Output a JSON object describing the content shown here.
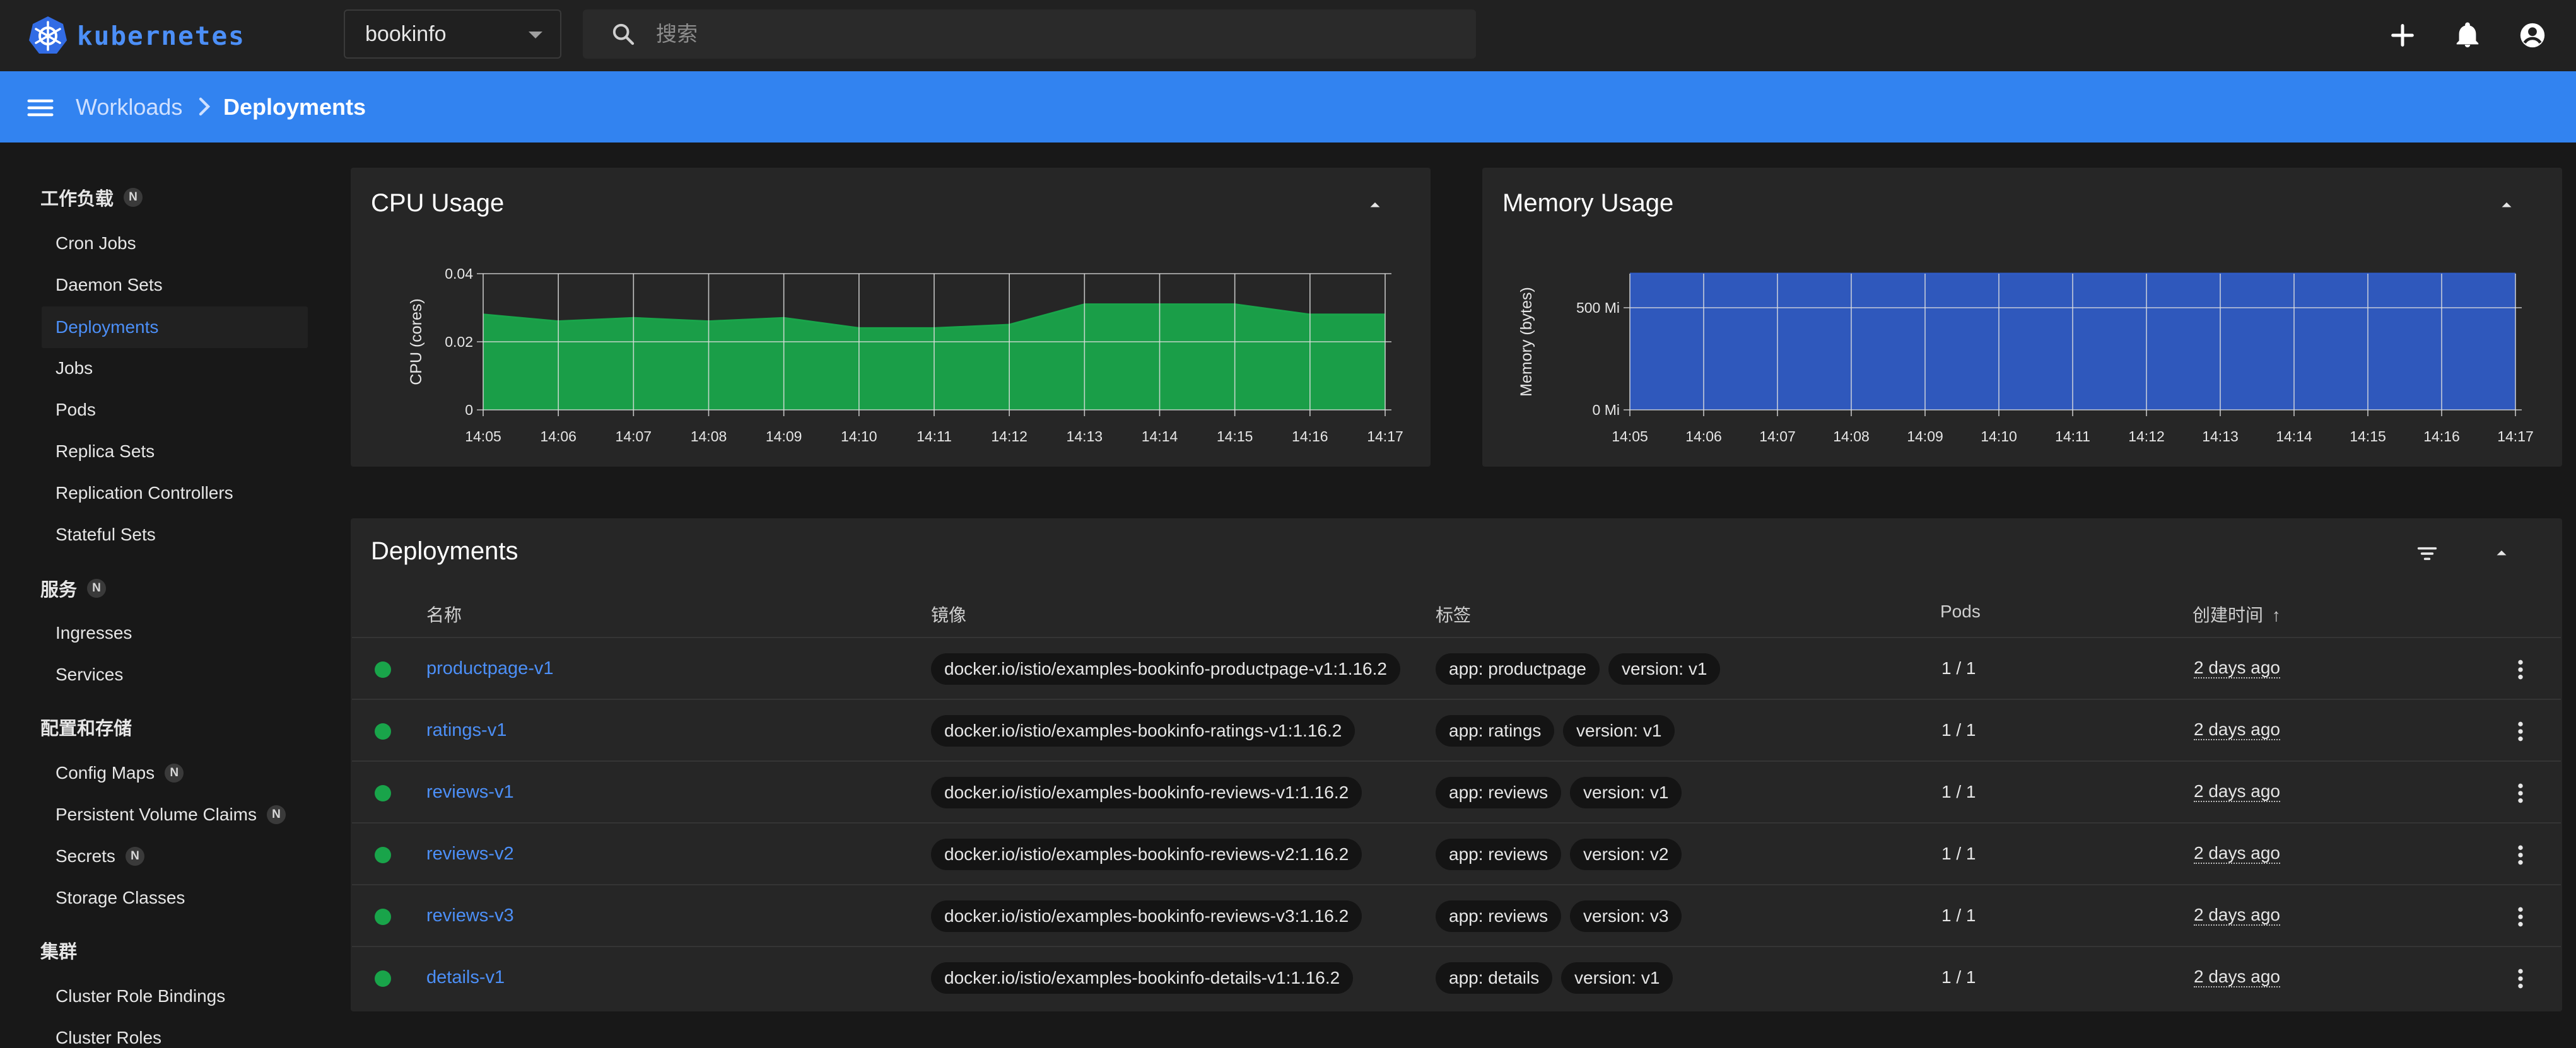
{
  "app": {
    "brand": "kubernetes"
  },
  "namespace": {
    "selected": "bookinfo"
  },
  "search": {
    "placeholder": "搜索"
  },
  "breadcrumb": {
    "parent": "Workloads",
    "current": "Deployments"
  },
  "sidebar": {
    "sections": [
      {
        "title": "工作负载",
        "badge": "N"
      },
      {
        "title": "服务",
        "badge": "N"
      },
      {
        "title": "配置和存储",
        "badge": ""
      },
      {
        "title": "集群",
        "badge": ""
      }
    ],
    "workloads": [
      "Cron Jobs",
      "Daemon Sets",
      "Deployments",
      "Jobs",
      "Pods",
      "Replica Sets",
      "Replication Controllers",
      "Stateful Sets"
    ],
    "services": [
      "Ingresses",
      "Services"
    ],
    "config": [
      {
        "label": "Config Maps",
        "badge": "N"
      },
      {
        "label": "Persistent Volume Claims",
        "badge": "N"
      },
      {
        "label": "Secrets",
        "badge": "N"
      },
      {
        "label": "Storage Classes",
        "badge": ""
      }
    ],
    "cluster": [
      "Cluster Role Bindings",
      "Cluster Roles"
    ]
  },
  "chart_data": [
    {
      "type": "area",
      "title": "CPU Usage",
      "ylabel": "CPU (cores)",
      "xlabel": "",
      "x": [
        "14:05",
        "14:06",
        "14:07",
        "14:08",
        "14:09",
        "14:10",
        "14:11",
        "14:12",
        "14:13",
        "14:14",
        "14:15",
        "14:16",
        "14:17"
      ],
      "values": [
        0.028,
        0.026,
        0.027,
        0.026,
        0.027,
        0.024,
        0.024,
        0.025,
        0.031,
        0.031,
        0.031,
        0.028,
        0.028
      ],
      "yticks": [
        "0",
        "0.02",
        "0.04"
      ],
      "ylim": [
        0,
        0.04
      ],
      "color": "#19a44a",
      "grid": true
    },
    {
      "type": "area",
      "title": "Memory Usage",
      "ylabel": "Memory (bytes)",
      "xlabel": "",
      "x": [
        "14:05",
        "14:06",
        "14:07",
        "14:08",
        "14:09",
        "14:10",
        "14:11",
        "14:12",
        "14:13",
        "14:14",
        "14:15",
        "14:16",
        "14:17"
      ],
      "values": [
        800,
        800,
        800,
        800,
        800,
        800,
        800,
        800,
        800,
        800,
        800,
        800,
        800
      ],
      "yticks": [
        "0 Mi",
        "500 Mi"
      ],
      "ylim": [
        0,
        800
      ],
      "color": "#2f5bc4",
      "grid": true
    }
  ],
  "deployments": {
    "title": "Deployments",
    "columns": [
      "名称",
      "镜像",
      "标签",
      "Pods",
      "创建时间"
    ],
    "sort_arrow": "↑",
    "rows": [
      {
        "name": "productpage-v1",
        "image": "docker.io/istio/examples-bookinfo-productpage-v1:1.16.2",
        "labels": [
          "app: productpage",
          "version: v1"
        ],
        "pods": "1 / 1",
        "created": "2 days ago"
      },
      {
        "name": "ratings-v1",
        "image": "docker.io/istio/examples-bookinfo-ratings-v1:1.16.2",
        "labels": [
          "app: ratings",
          "version: v1"
        ],
        "pods": "1 / 1",
        "created": "2 days ago"
      },
      {
        "name": "reviews-v1",
        "image": "docker.io/istio/examples-bookinfo-reviews-v1:1.16.2",
        "labels": [
          "app: reviews",
          "version: v1"
        ],
        "pods": "1 / 1",
        "created": "2 days ago"
      },
      {
        "name": "reviews-v2",
        "image": "docker.io/istio/examples-bookinfo-reviews-v2:1.16.2",
        "labels": [
          "app: reviews",
          "version: v2"
        ],
        "pods": "1 / 1",
        "created": "2 days ago"
      },
      {
        "name": "reviews-v3",
        "image": "docker.io/istio/examples-bookinfo-reviews-v3:1.16.2",
        "labels": [
          "app: reviews",
          "version: v3"
        ],
        "pods": "1 / 1",
        "created": "2 days ago"
      },
      {
        "name": "details-v1",
        "image": "docker.io/istio/examples-bookinfo-details-v1:1.16.2",
        "labels": [
          "app: details",
          "version: v1"
        ],
        "pods": "1 / 1",
        "created": "2 days ago"
      }
    ]
  }
}
